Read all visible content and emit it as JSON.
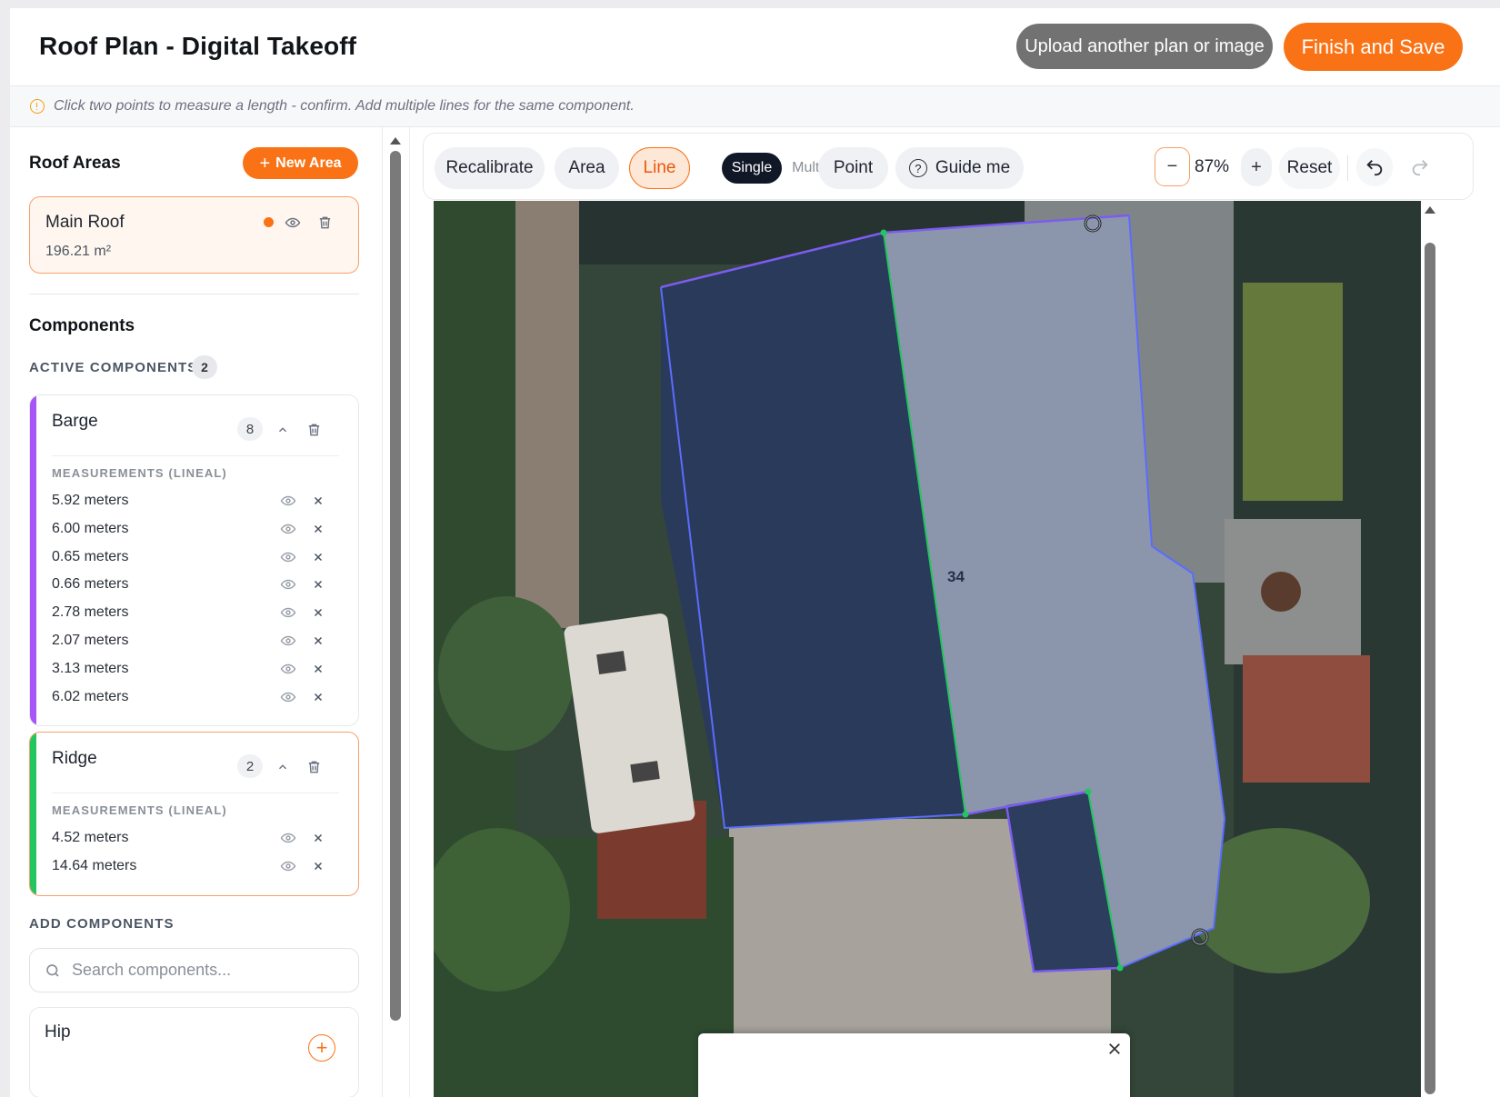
{
  "header": {
    "title": "Roof Plan - Digital Takeoff",
    "upload_label": "Upload another plan or image",
    "finish_label": "Finish and Save"
  },
  "hint": {
    "text": "Click two points to measure a length - confirm. Add multiple lines for the same component."
  },
  "sidebar": {
    "roof_areas_title": "Roof Areas",
    "new_area_label": "New Area",
    "areas": [
      {
        "name": "Main Roof",
        "size": "196.21 m²",
        "color": "#f97316"
      }
    ],
    "components_title": "Components",
    "active_components_label": "ACTIVE COMPONENTS",
    "active_count": "2",
    "components": [
      {
        "name": "Barge",
        "count": "8",
        "color": "#a855f7",
        "measurements_label": "MEASUREMENTS (LINEAL)",
        "measurements": [
          "5.92 meters",
          "6.00 meters",
          "0.65 meters",
          "0.66 meters",
          "2.78 meters",
          "2.07 meters",
          "3.13 meters",
          "6.02 meters"
        ]
      },
      {
        "name": "Ridge",
        "count": "2",
        "color": "#22c55e",
        "measurements_label": "MEASUREMENTS (LINEAL)",
        "measurements": [
          "4.52 meters",
          "14.64 meters"
        ]
      }
    ],
    "add_components_label": "ADD COMPONENTS",
    "search_placeholder": "Search components...",
    "available": [
      {
        "name": "Hip"
      }
    ]
  },
  "toolbar": {
    "recalibrate": "Recalibrate",
    "area": "Area",
    "line": "Line",
    "single": "Single",
    "multi": "Multi",
    "point": "Point",
    "guide": "Guide me",
    "zoom_minus": "−",
    "zoom_value": "87%",
    "zoom_plus": "+",
    "reset": "Reset",
    "active_tool": "Line",
    "line_mode": "Single"
  },
  "map": {
    "label": "34"
  },
  "colors": {
    "accent": "#f97316",
    "barge": "#a855f7",
    "ridge": "#22c55e",
    "area_outline": "#5b6cff"
  }
}
